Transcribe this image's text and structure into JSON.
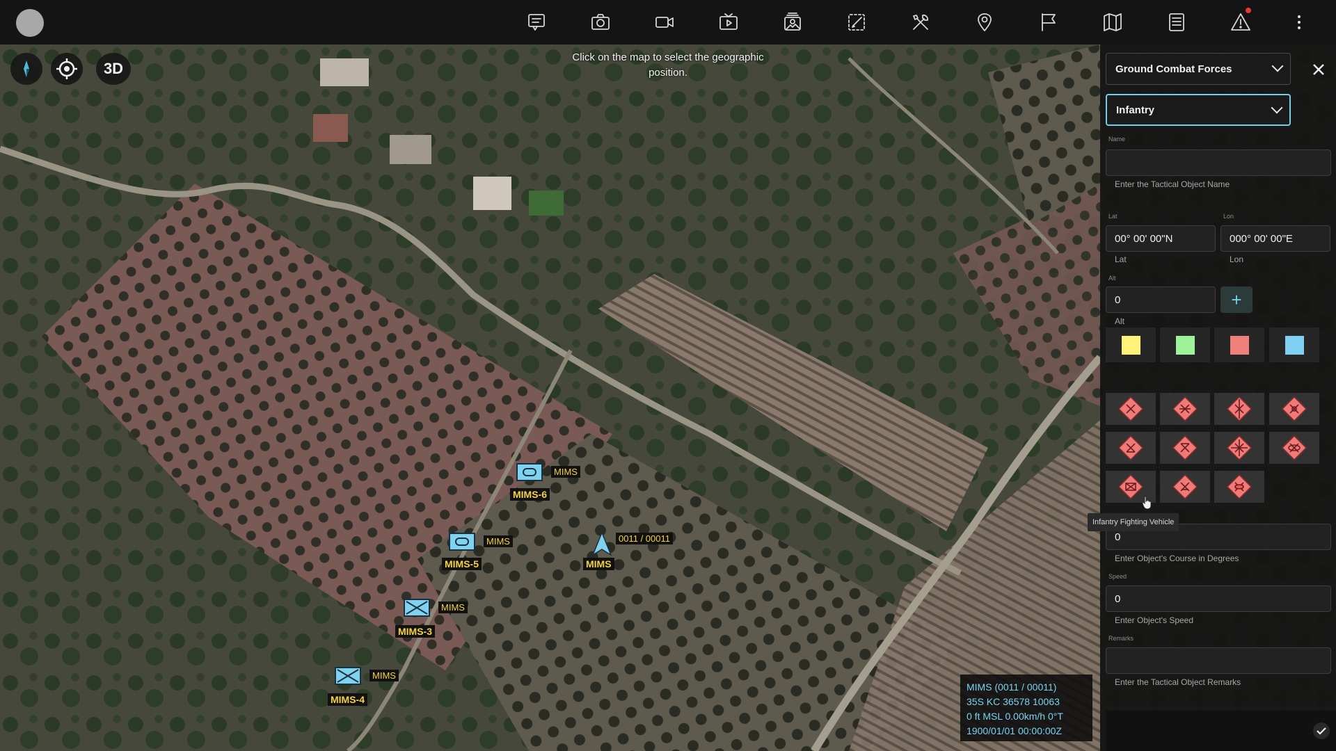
{
  "toolbar": {
    "items": [
      {
        "name": "chat-icon"
      },
      {
        "name": "camera-icon"
      },
      {
        "name": "video-icon"
      },
      {
        "name": "video-playlist-icon"
      },
      {
        "name": "image-gallery-icon"
      },
      {
        "name": "draw-edit-icon"
      },
      {
        "name": "tools-icon"
      },
      {
        "name": "location-pin-icon"
      },
      {
        "name": "flag-icon"
      },
      {
        "name": "map-icon"
      },
      {
        "name": "list-document-icon"
      },
      {
        "name": "warning-icon",
        "has_notification": true
      }
    ],
    "more_icon": "more-vertical-icon"
  },
  "map": {
    "hint": "Click on the map to select the geographic position.",
    "mode_3d_label": "3D",
    "units": [
      {
        "id": "MIMS-6",
        "label": "MIMS-6",
        "tag": "MIMS"
      },
      {
        "id": "MIMS-5",
        "label": "MIMS-5",
        "tag": "MIMS"
      },
      {
        "id": "MIMS-3",
        "label": "MIMS-3",
        "tag": "MIMS"
      },
      {
        "id": "MIMS-4",
        "label": "MIMS-4",
        "tag": "MIMS"
      },
      {
        "id": "MIMS",
        "label": "MIMS",
        "tag": "0011 / 00011"
      }
    ],
    "info": {
      "line1": "MIMS (0011 / 00011)",
      "line2": "35S KC 36578 10063",
      "line3": "0 ft MSL   0.00km/h    0°T",
      "line4": "1900/01/01 00:00:00Z"
    }
  },
  "panel": {
    "category": "Ground Combat Forces",
    "type": "Infantry",
    "name": {
      "label": "Name",
      "value": "",
      "help": "Enter the Tactical Object Name"
    },
    "lat": {
      "label": "Lat",
      "value": "00° 00' 00\"N",
      "help": "Lat"
    },
    "lon": {
      "label": "Lon",
      "value": "000° 00' 00\"E",
      "help": "Lon"
    },
    "alt": {
      "label": "Alt",
      "value": "0",
      "help": "Alt"
    },
    "colors": [
      "#fff27a",
      "#9df29a",
      "#f0807a",
      "#7fd0f2"
    ],
    "symbol_count": 11,
    "tooltip": "Infantry Fighting Vehicle",
    "course": {
      "value": "0",
      "help": "Enter Object's Course in Degrees"
    },
    "speed": {
      "label": "Speed",
      "value": "0",
      "help": "Enter Object's Speed"
    },
    "remarks": {
      "label": "Remarks",
      "value": "",
      "help": "Enter the Tactical Object Remarks"
    }
  }
}
